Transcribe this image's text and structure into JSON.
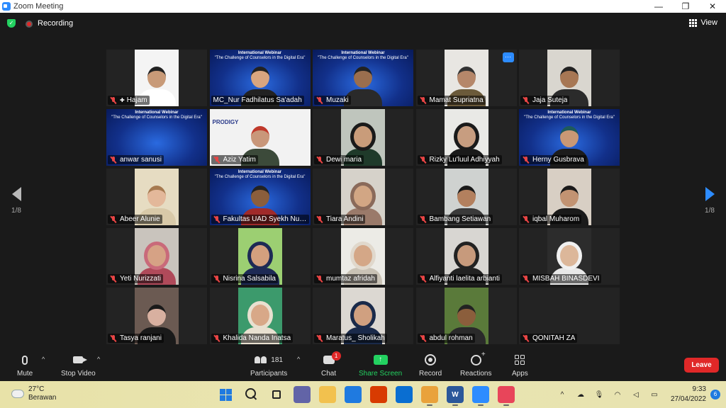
{
  "window": {
    "title": "Zoom Meeting",
    "minimize": "—",
    "maximize": "❐",
    "close": "✕"
  },
  "topbar": {
    "recording_label": "Recording",
    "view_label": "View"
  },
  "nav": {
    "page_left": "1/8",
    "page_right": "1/8"
  },
  "webinar": {
    "title": "International Webinar",
    "subtitle": "\"The Challenge of Counselors in the Digital Era\""
  },
  "participants": [
    {
      "name": "Hajam",
      "muted": true,
      "pinned": true,
      "bg": "#f4f4f4",
      "skin": "#c89a78",
      "shirt": "#ffffff",
      "hair": "#222222",
      "style": "person"
    },
    {
      "name": "MC_Nur Fadhilatus Sa'adah",
      "muted": false,
      "pinned": false,
      "active": true,
      "bg": "#10328f",
      "skin": "#d9a57f",
      "shirt": "#222222",
      "hair": "#222222",
      "style": "webinar"
    },
    {
      "name": "Muzaki",
      "muted": true,
      "pinned": false,
      "bg": "#10328f",
      "skin": "#9a6e4e",
      "shirt": "#2a2a2a",
      "hair": "#222222",
      "style": "webinar"
    },
    {
      "name": "Mamat Supriatna",
      "muted": true,
      "pinned": false,
      "bg": "#e8e6e2",
      "skin": "#b5876a",
      "shirt": "#6b5a3a",
      "hair": "#333333",
      "style": "person",
      "more": true
    },
    {
      "name": "Jaja Suteja",
      "muted": true,
      "pinned": false,
      "bg": "#d9d6cf",
      "skin": "#a77754",
      "shirt": "#2b2b2b",
      "hair": "#222222",
      "style": "person"
    },
    {
      "name": "anwar sanusi",
      "muted": true,
      "pinned": false,
      "bg": "#10328f",
      "skin": "",
      "shirt": "",
      "hair": "",
      "style": "webinar-empty"
    },
    {
      "name": "Aziz Yatim",
      "muted": true,
      "pinned": false,
      "bg": "#f2f2f2",
      "skin": "#c9977a",
      "shirt": "#3c4a3a",
      "hair": "#c0392b",
      "style": "prodigy"
    },
    {
      "name": "Dewi maria",
      "muted": true,
      "pinned": false,
      "bg": "#bfc5bd",
      "skin": "#c99c7a",
      "shirt": "#1f3a2a",
      "hair": "#1a1a1a",
      "style": "hijab"
    },
    {
      "name": "Rizky Lu'luul Adhiyyah",
      "muted": true,
      "pinned": false,
      "bg": "#e9e9e6",
      "skin": "#c79d80",
      "shirt": "#1a1a1a",
      "hair": "#1a1a1a",
      "style": "hijab"
    },
    {
      "name": "Herny Gusbrava",
      "muted": true,
      "pinned": false,
      "bg": "#10328f",
      "skin": "#c99875",
      "shirt": "#1c1c1c",
      "hair": "#1f5a5a",
      "style": "webinar"
    },
    {
      "name": "Abeer Alunie",
      "muted": true,
      "pinned": false,
      "bg": "#e6dcc2",
      "skin": "#e3b89a",
      "shirt": "#d8c9a8",
      "hair": "#a67a50",
      "style": "person"
    },
    {
      "name": "Fakultas UAD Syekh Nurjati",
      "muted": true,
      "pinned": false,
      "bg": "#10328f",
      "skin": "#8b5e3c",
      "shirt": "#a02a2a",
      "hair": "#222222",
      "style": "webinar"
    },
    {
      "name": "Tiara Andini",
      "muted": true,
      "pinned": false,
      "bg": "#d6d2ca",
      "skin": "#d2a684",
      "shirt": "#9a7a6a",
      "hair": "#8a6a5a",
      "style": "hijab"
    },
    {
      "name": "Bambang Setiawan",
      "muted": true,
      "pinned": false,
      "bg": "#cfd2d0",
      "skin": "#b3805e",
      "shirt": "#3a3a3a",
      "hair": "#1a1a1a",
      "style": "person"
    },
    {
      "name": "iqbal Muharom",
      "muted": true,
      "pinned": false,
      "bg": "#d8cfc4",
      "skin": "#c29372",
      "shirt": "#1a1a1a",
      "hair": "#1a1a1a",
      "style": "person"
    },
    {
      "name": "Yeti Nurizzati",
      "muted": true,
      "pinned": false,
      "bg": "#c9c4bd",
      "skin": "#d6a285",
      "shirt": "#b04a5a",
      "hair": "#c96a7a",
      "style": "hijab"
    },
    {
      "name": "Nisrina Salsabila",
      "muted": true,
      "pinned": false,
      "bg": "#9ccf72",
      "skin": "#d3a07e",
      "shirt": "#1d2a55",
      "hair": "#1d2a55",
      "style": "hijab"
    },
    {
      "name": "mumtaz afridah",
      "muted": true,
      "pinned": false,
      "bg": "#ecebe6",
      "skin": "#d4a787",
      "shirt": "#c9c2b5",
      "hair": "#e0d8cc",
      "style": "hijab"
    },
    {
      "name": "Alfiyanti laelita arbianti",
      "muted": true,
      "pinned": false,
      "bg": "#d8d6d2",
      "skin": "#c79a7c",
      "shirt": "#222222",
      "hair": "#222222",
      "style": "hijab"
    },
    {
      "name": "MISBAH BINASDEVI",
      "muted": true,
      "pinned": false,
      "bg": "#2c2c2c",
      "skin": "#dcb79a",
      "shirt": "#e8e8e8",
      "hair": "#f0f0f0",
      "style": "hijab"
    },
    {
      "name": "Tasya ranjani",
      "muted": true,
      "pinned": false,
      "bg": "#6b5a52",
      "skin": "#d8b0a0",
      "shirt": "#1a1a1a",
      "hair": "#1a1a1a",
      "style": "person"
    },
    {
      "name": "Khalida Nanda Inatsa",
      "muted": true,
      "pinned": false,
      "bg": "#3c9a6c",
      "skin": "#d8a888",
      "shirt": "#e8e0d0",
      "hair": "#e8e0d0",
      "style": "hijab"
    },
    {
      "name": "Maratus_ Sholikah",
      "muted": true,
      "pinned": false,
      "bg": "#dcd8d2",
      "skin": "#d0a080",
      "shirt": "#1a2a4a",
      "hair": "#1a2a4a",
      "style": "hijab"
    },
    {
      "name": "abdul rohman",
      "muted": true,
      "pinned": false,
      "bg": "#5a7a3a",
      "skin": "#8b5e3c",
      "shirt": "#2a2a2a",
      "hair": "#222222",
      "style": "person"
    },
    {
      "name": "QONITAH ZA",
      "muted": true,
      "pinned": false,
      "bg": "",
      "skin": "",
      "shirt": "",
      "hair": "",
      "style": "empty"
    }
  ],
  "toolbar": {
    "mute": "Mute",
    "stop_video": "Stop Video",
    "participants": "Participants",
    "participants_count": "181",
    "chat": "Chat",
    "chat_badge": "1",
    "share_screen": "Share Screen",
    "record": "Record",
    "reactions": "Reactions",
    "apps": "Apps",
    "leave": "Leave"
  },
  "taskbar": {
    "temperature": "27°C",
    "weather": "Berawan",
    "time": "9:33",
    "date": "27/04/2022",
    "notifications": "6",
    "apps": [
      {
        "name": "start-button",
        "label": "",
        "color": ""
      },
      {
        "name": "search-button",
        "label": "",
        "color": ""
      },
      {
        "name": "task-view-button",
        "label": "",
        "color": ""
      },
      {
        "name": "chat-app",
        "label": "",
        "color": "#6264a7"
      },
      {
        "name": "file-explorer",
        "label": "",
        "color": "#f2c14e"
      },
      {
        "name": "mail-app",
        "label": "",
        "color": "#1f7ae0"
      },
      {
        "name": "office-app",
        "label": "",
        "color": "#d83b01"
      },
      {
        "name": "security-app",
        "label": "",
        "color": "#0a6ed1"
      },
      {
        "name": "chrome-app",
        "label": "",
        "color": "#e9a23b"
      },
      {
        "name": "word-app",
        "label": "W",
        "color": "#2b579a"
      },
      {
        "name": "zoom-app",
        "label": "",
        "color": "#2D8CFF"
      },
      {
        "name": "snipping-tool",
        "label": "",
        "color": "#e8455a"
      }
    ]
  }
}
